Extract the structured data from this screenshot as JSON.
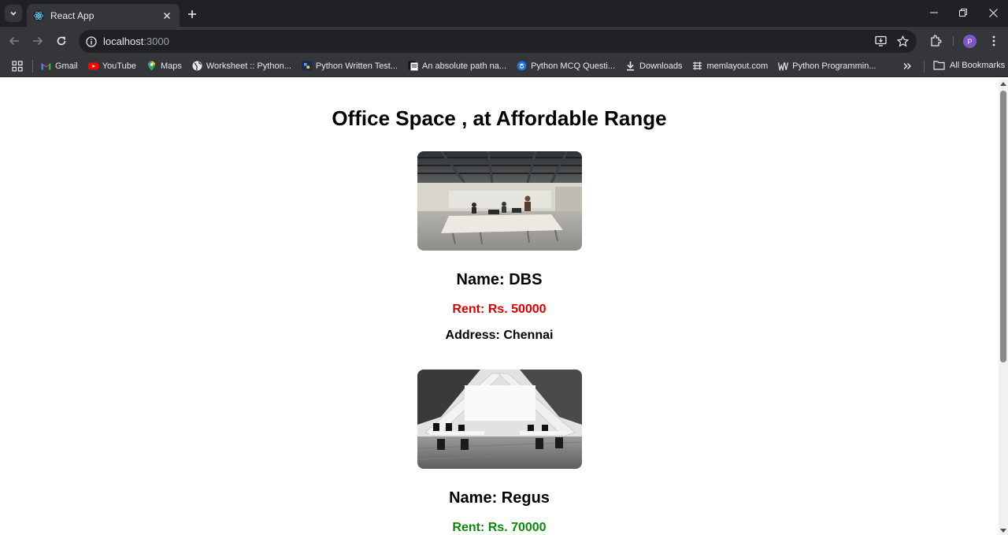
{
  "browser": {
    "tab_title": "React App",
    "url_host": "localhost",
    "url_port": ":3000",
    "profile_initial": "P",
    "bookmarks": [
      {
        "label": "Gmail",
        "icon": "gmail-icon"
      },
      {
        "label": "YouTube",
        "icon": "youtube-icon"
      },
      {
        "label": "Maps",
        "icon": "maps-icon"
      },
      {
        "label": "Worksheet :: Python...",
        "icon": "globe-icon"
      },
      {
        "label": "Python Written Test...",
        "icon": "python-test-icon"
      },
      {
        "label": "An absolute path na...",
        "icon": "document-icon"
      },
      {
        "label": "Python MCQ Questi...",
        "icon": "mcq-icon"
      },
      {
        "label": "Downloads",
        "icon": "download-icon"
      },
      {
        "label": "memlayout.com",
        "icon": "memlayout-icon"
      },
      {
        "label": "Python Programmin...",
        "icon": "w3-icon"
      }
    ],
    "all_bookmarks_label": "All Bookmarks"
  },
  "page": {
    "title": "Office Space , at Affordable Range",
    "offices": [
      {
        "name": "Name: DBS",
        "rent": "Rent: Rs. 50000",
        "rent_color": "#e00000",
        "address": "Address: Chennai",
        "image": "office-color-photo"
      },
      {
        "name": "Name: Regus",
        "rent": "Rent: Rs. 70000",
        "rent_color": "#0a8a0a",
        "image": "office-grayscale-photo"
      }
    ]
  }
}
